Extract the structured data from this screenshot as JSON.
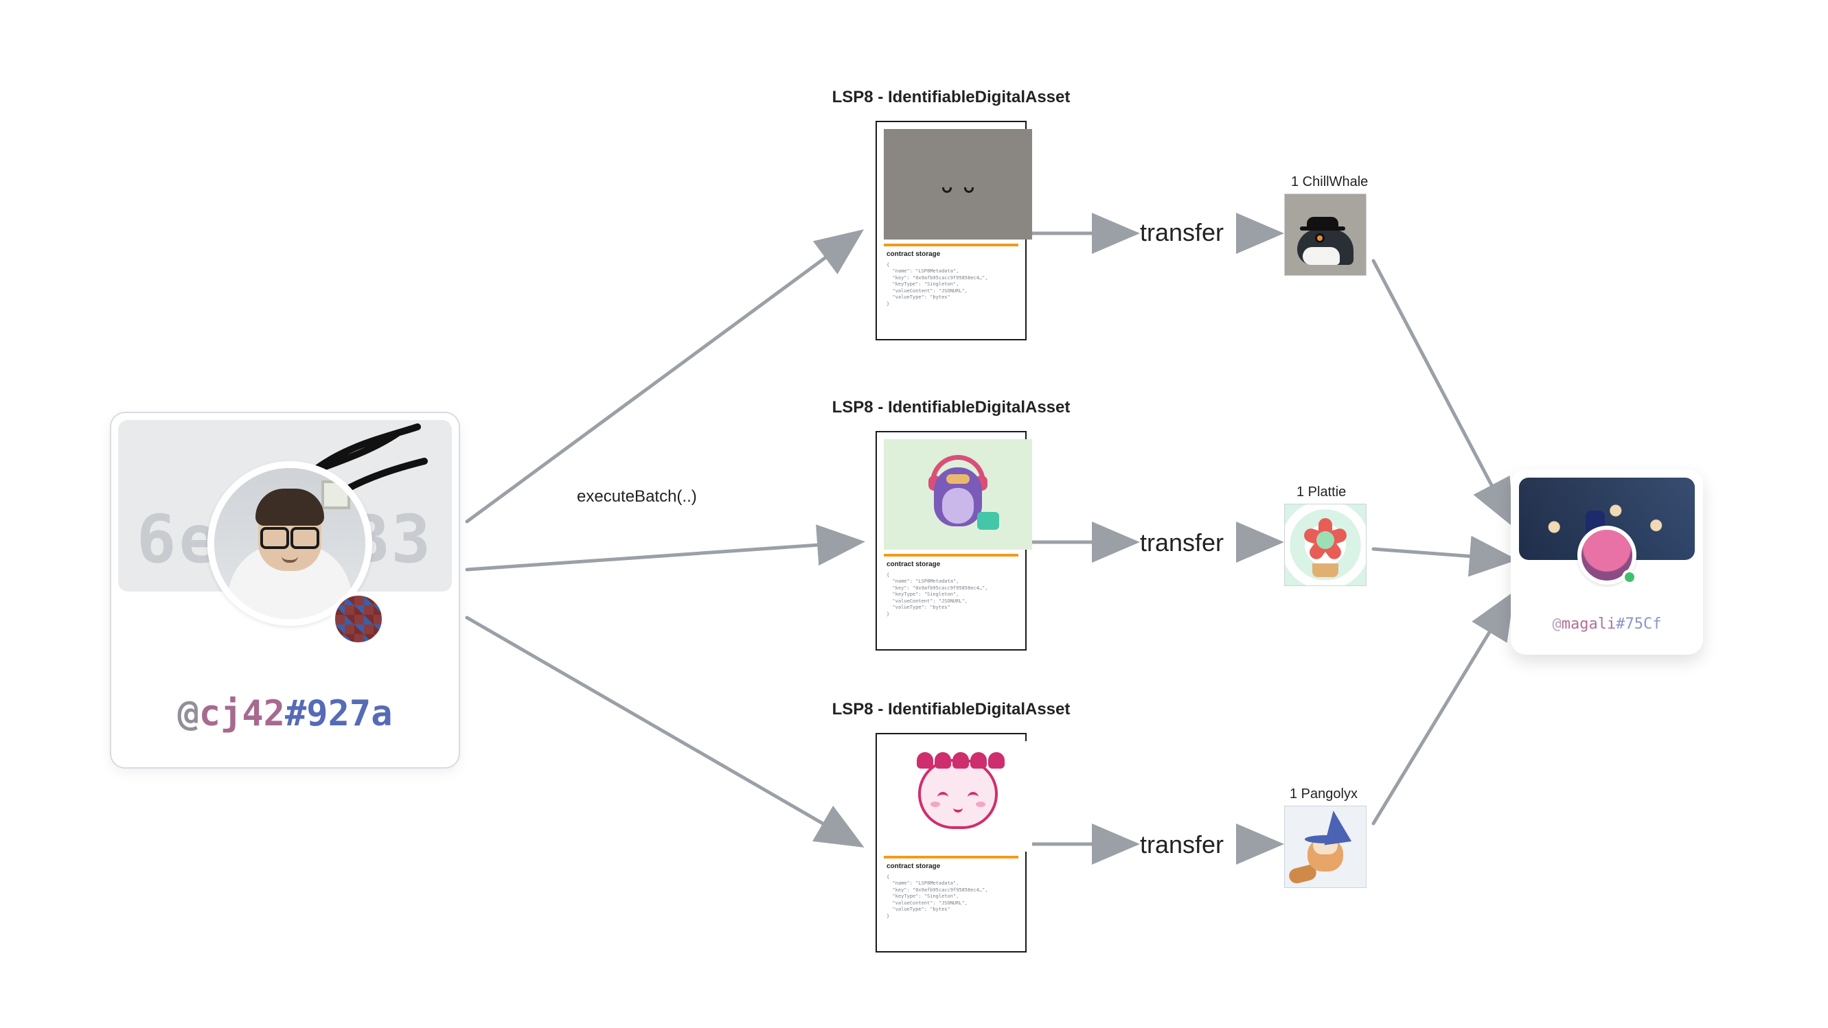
{
  "sender": {
    "coverAddressFragment": "6ee        /B3",
    "handle": {
      "at": "@",
      "name": "cj42",
      "hash": "#927a"
    }
  },
  "action": {
    "label": "executeBatch(..)"
  },
  "assets": [
    {
      "title": "LSP8 - IdentifiableDigitalAsset",
      "storageLabel": "contract storage",
      "storageJson": "{\n  \"name\": \"LSP8Metadata\",\n  \"key\": \"0x9afb95cacc9f95858ec4…\",\n  \"keyType\": \"Singleton\",\n  \"valueContent\": \"JSONURL\",\n  \"valueType\": \"bytes\"\n}",
      "transferLabel": "transfer",
      "nft": {
        "caption": "1 ChillWhale"
      }
    },
    {
      "title": "LSP8 - IdentifiableDigitalAsset",
      "storageLabel": "contract storage",
      "storageJson": "{\n  \"name\": \"LSP8Metadata\",\n  \"key\": \"0x9afb95cacc9f95858ec4…\",\n  \"keyType\": \"Singleton\",\n  \"valueContent\": \"JSONURL\",\n  \"valueType\": \"bytes\"\n}",
      "transferLabel": "transfer",
      "nft": {
        "caption": "1 Plattie"
      }
    },
    {
      "title": "LSP8 - IdentifiableDigitalAsset",
      "storageLabel": "contract storage",
      "storageJson": "{\n  \"name\": \"LSP8Metadata\",\n  \"key\": \"0x9afb95cacc9f95858ec4…\",\n  \"keyType\": \"Singleton\",\n  \"valueContent\": \"JSONURL\",\n  \"valueType\": \"bytes\"\n}",
      "transferLabel": "transfer",
      "nft": {
        "caption": "1 Pangolyx"
      }
    }
  ],
  "recipient": {
    "handle": {
      "at": "@",
      "name": "magali",
      "hash": "#75Cf"
    }
  }
}
